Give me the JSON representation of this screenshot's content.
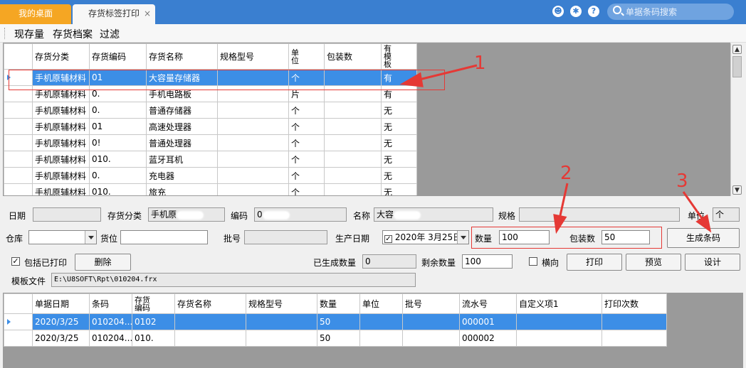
{
  "tabs": {
    "desktop": "我的桌面",
    "label_print": "存货标签打印",
    "close_glyph": "×"
  },
  "header_icons": {
    "face": "☻",
    "gear": "✱",
    "help": "?"
  },
  "search": {
    "placeholder": "单据条码搜索"
  },
  "toolbar": {
    "stock": "现存量",
    "inventory": "存货档案",
    "filter": "过滤"
  },
  "top_grid": {
    "columns": [
      "存货分类",
      "存货编码",
      "存货名称",
      "规格型号",
      "单位",
      "包装数",
      "有模板"
    ],
    "rows": [
      [
        "手机原辅材料",
        "01",
        "大容量存储器",
        "",
        "个",
        "",
        "有"
      ],
      [
        "手机原辅材料",
        "0.",
        "手机电路板",
        "",
        "片",
        "",
        "有"
      ],
      [
        "手机原辅材料",
        "0.",
        "普通存储器",
        "",
        "个",
        "",
        "无"
      ],
      [
        "手机原辅材料",
        "01",
        "高速处理器",
        "",
        "个",
        "",
        "无"
      ],
      [
        "手机原辅材料",
        "0!",
        "普通处理器",
        "",
        "个",
        "",
        "无"
      ],
      [
        "手机原辅材料",
        "010.",
        "蓝牙耳机",
        "",
        "个",
        "",
        "无"
      ],
      [
        "手机原辅材料",
        "0.",
        "充电器",
        "",
        "个",
        "",
        "无"
      ],
      [
        "手机原辅材料",
        "010.",
        "旅充",
        "",
        "个",
        "",
        "无"
      ]
    ]
  },
  "form": {
    "date_label": "日期",
    "date_value": "",
    "category_label": "存货分类",
    "category_value": "手机原",
    "code_label": "编码",
    "code_value": "0",
    "name_label": "名称",
    "name_value": "大容",
    "spec_label": "规格",
    "spec_value": "",
    "unit_label": "单位",
    "unit_value": "个",
    "warehouse_label": "仓库",
    "location_label": "货位",
    "batch_label": "批号",
    "prod_date_label": "生产日期",
    "prod_date_value": "2020年  3月25日",
    "qty_label": "数量",
    "qty_value": "100",
    "pack_label": "包装数",
    "pack_value": "50",
    "generate_btn": "生成条码",
    "include_printed_label": "包括已打印",
    "delete_btn": "删除",
    "generated_qty_label": "已生成数量",
    "generated_qty_value": "0",
    "remaining_qty_label": "剩余数量",
    "remaining_qty_value": "100",
    "landscape_label": "横向",
    "print_btn": "打印",
    "preview_btn": "预览",
    "design_btn": "设计",
    "template_label": "模板文件",
    "template_value": "E:\\U8SOFT\\Rpt\\010204.frx"
  },
  "bottom_grid": {
    "columns": [
      "单据日期",
      "条码",
      "存货编码",
      "存货名称",
      "规格型号",
      "数量",
      "单位",
      "批号",
      "流水号",
      "自定义项1",
      "打印次数"
    ],
    "rows": [
      [
        "2020/3/25",
        "010204...",
        "0102",
        "",
        "",
        "50",
        "",
        "",
        "000001",
        "",
        ""
      ],
      [
        "2020/3/25",
        "010204...",
        "010.",
        "",
        "",
        "50",
        "",
        "",
        "000002",
        "",
        ""
      ]
    ]
  },
  "annotations": {
    "n1": "1",
    "n2": "2",
    "n3": "3"
  },
  "colors": {
    "accent": "#3a7fd0",
    "selection": "#3c8ee6",
    "annotation": "#e53935",
    "desktop_tab": "#f5a623"
  }
}
